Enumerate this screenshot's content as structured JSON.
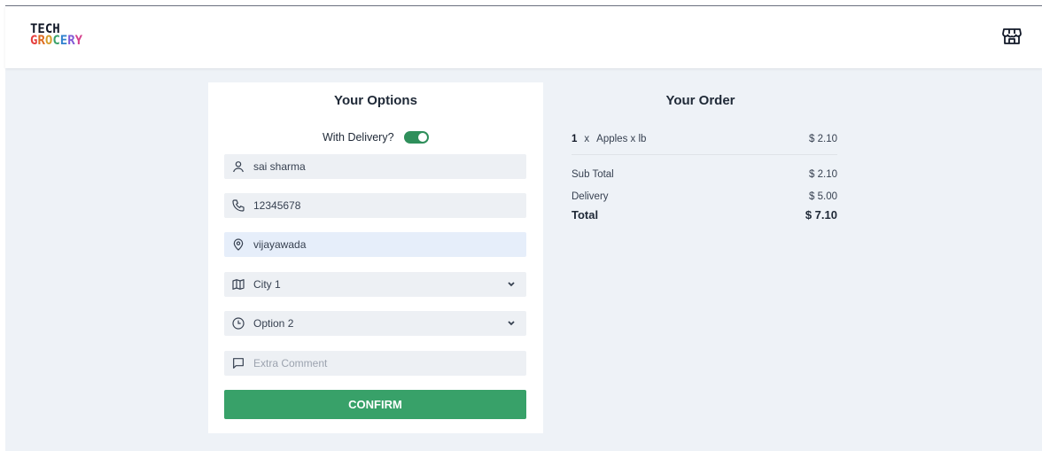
{
  "header": {
    "logo_line1": "TECH",
    "logo_line2_letters": [
      "G",
      "R",
      "O",
      "C",
      "E",
      "R",
      "Y"
    ],
    "logo_colors": [
      "#e53e3e",
      "#dd6b20",
      "#d69e2e",
      "#38a169",
      "#3182ce",
      "#805ad5",
      "#d53f8c"
    ],
    "store_icon": "store-icon"
  },
  "options": {
    "title": "Your Options",
    "delivery_label": "With Delivery?",
    "delivery_enabled": true,
    "name_value": "sai sharma",
    "phone_value": "12345678",
    "address_value": "vijayawada",
    "city_selected": "City 1",
    "time_selected": "Option 2",
    "comment_placeholder": "Extra Comment",
    "confirm_label": "CONFIRM"
  },
  "order": {
    "title": "Your Order",
    "items": [
      {
        "qty": "1",
        "x": "x",
        "name": "Apples x lb",
        "price": "$ 2.10"
      }
    ],
    "subtotal_label": "Sub Total",
    "subtotal_value": "$ 2.10",
    "delivery_label": "Delivery",
    "delivery_value": "$ 5.00",
    "total_label": "Total",
    "total_value": "$ 7.10"
  },
  "colors": {
    "accent": "#38a169",
    "toggle": "#2f8f5b",
    "page_bg": "#eef2f7"
  }
}
